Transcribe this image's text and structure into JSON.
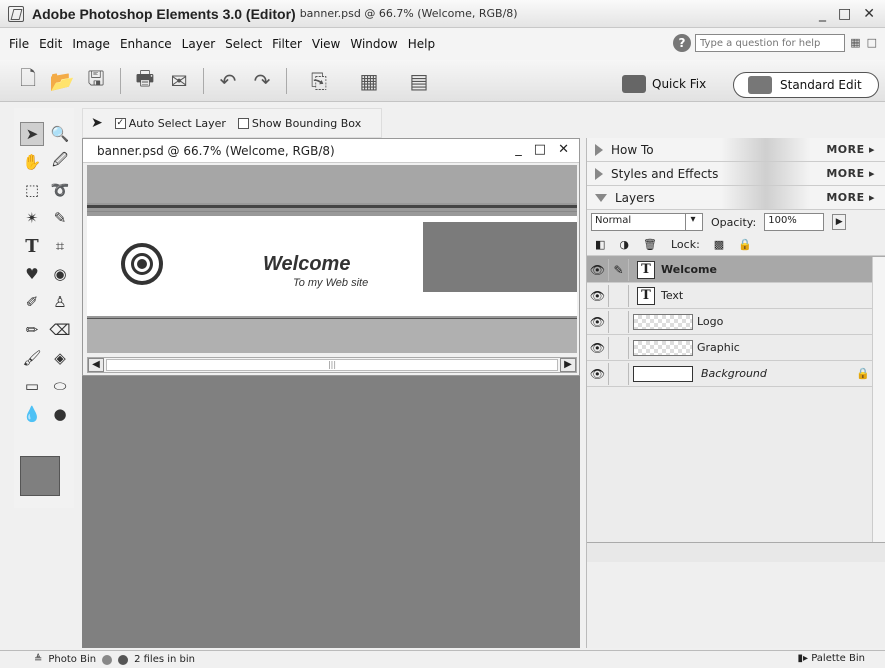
{
  "window": {
    "app_title": "Adobe Photoshop Elements 3.0 (Editor)",
    "doc_info": "banner.psd @ 66.7% (Welcome, RGB/8)"
  },
  "menu": [
    "File",
    "Edit",
    "Image",
    "Enhance",
    "Layer",
    "Select",
    "Filter",
    "View",
    "Window",
    "Help"
  ],
  "help": {
    "placeholder": "Type a question for help"
  },
  "modes": {
    "quick_fix": "Quick Fix",
    "standard_edit": "Standard Edit"
  },
  "options": {
    "auto_select": "Auto Select Layer",
    "auto_select_checked": true,
    "bounding_box": "Show Bounding Box",
    "bounding_box_checked": false
  },
  "document": {
    "title": "banner.psd @ 66.7% (Welcome, RGB/8)",
    "banner_heading": "Welcome",
    "banner_sub": "To my Web site"
  },
  "palettes": {
    "how_to": "How To",
    "styles": "Styles and Effects",
    "layers": "Layers",
    "more": "MORE"
  },
  "layers_panel": {
    "blend_mode": "Normal",
    "opacity_label": "Opacity:",
    "opacity_value": "100%",
    "lock_label": "Lock:",
    "rows": [
      {
        "name": "Welcome",
        "kind": "text",
        "selected": true
      },
      {
        "name": "Text",
        "kind": "text",
        "selected": false
      },
      {
        "name": "Logo",
        "kind": "pixel",
        "selected": false
      },
      {
        "name": "Graphic",
        "kind": "pixel",
        "selected": false
      },
      {
        "name": "Background",
        "kind": "background",
        "selected": false
      }
    ]
  },
  "status": {
    "photo_bin": "Photo Bin",
    "files": "2 files in bin",
    "palette_bin": "Palette Bin"
  }
}
